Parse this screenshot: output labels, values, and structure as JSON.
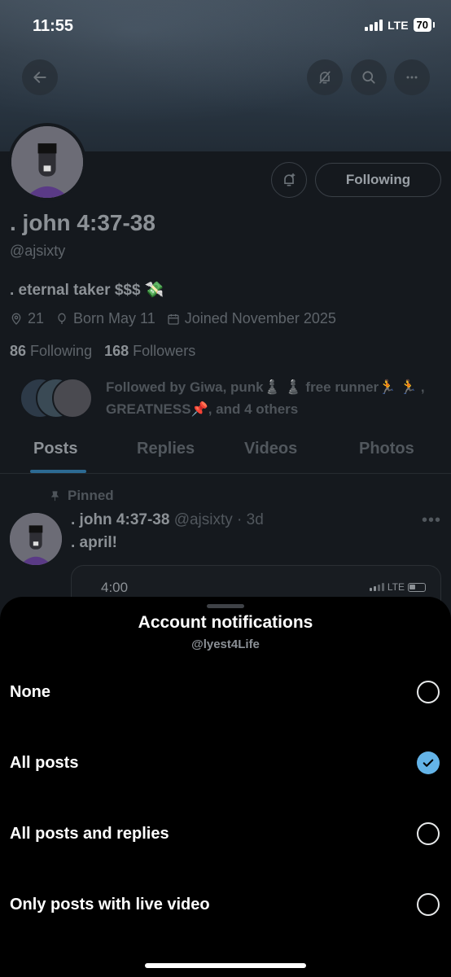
{
  "status_bar": {
    "time": "11:55",
    "network": "LTE",
    "battery": "70"
  },
  "profile": {
    "follow_button": "Following",
    "name": ". john 4:37-38",
    "handle": "@ajsixty",
    "bio": ". eternal taker $$$ 💸",
    "location": "21",
    "birthday": "Born May 11",
    "joined": "Joined November 2025",
    "following_count": "86",
    "following_label": "Following",
    "followers_count": "168",
    "followers_label": "Followers",
    "followed_by": "Followed by Giwa, punk♟️ ♟️ free runner🏃 🏃 , GREATNESS📌, and 4 others"
  },
  "tabs": [
    {
      "label": "Posts",
      "active": true
    },
    {
      "label": "Replies"
    },
    {
      "label": "Videos"
    },
    {
      "label": "Photos"
    }
  ],
  "pinned_post": {
    "pinned_label": "Pinned",
    "author": ". john 4:37-38",
    "handle_time": "@ajsixty · 3d",
    "text": ". april!",
    "embed_time": "4:00",
    "embed_network": "LTE"
  },
  "sheet": {
    "title": "Account notifications",
    "subtitle": "@lyest4Life",
    "options": [
      {
        "label": "None",
        "selected": false
      },
      {
        "label": "All posts",
        "selected": true
      },
      {
        "label": "All posts and replies",
        "selected": false
      },
      {
        "label": "Only posts with live video",
        "selected": false
      }
    ]
  },
  "colors": {
    "accent": "#64b4e8",
    "sheet_bg": "#000000"
  }
}
